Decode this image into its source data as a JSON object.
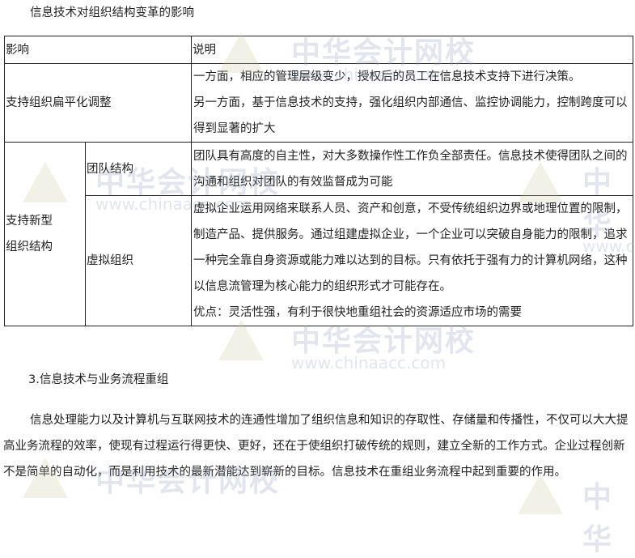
{
  "title": "信息技术对组织结构变革的影响",
  "table": {
    "headers": [
      "影响",
      "说明"
    ],
    "row1": {
      "impact": "支持组织扁平化调整",
      "desc_lines": [
        "一方面，相应的管理层级变少，授权后的员工在信息技术支持下进行决策。",
        "另一方面，基于信息技术的支持，强化组织内部通信、监控协调能力，控制跨度可以得到显著的扩大"
      ]
    },
    "group": {
      "impact_lines": [
        "支持新型",
        "组织结构"
      ],
      "team": {
        "label": "团队结构",
        "desc": "团队具有高度的自主性，对大多数操作性工作负全部责任。信息技术使得团队之间的沟通和组织对团队的有效监督成为可能"
      },
      "virtual": {
        "label": "虚拟组织",
        "desc": "虚拟企业运用网络来联系人员、资产和创意，不受传统组织边界或地理位置的限制，制造产品、提供服务。通过组建虚拟企业，一个企业可以突破自身能力的限制，追求一种完全靠自身资源或能力难以达到的目标。只有依托于强有力的计算机网络，这种以信息流管理为核心能力的组织形式才可能存在。",
        "advantage": "优点：灵活性强，有利于很快地重组社会的资源适应市场的需要"
      }
    }
  },
  "section_heading": "3.信息技术与业务流程重组",
  "paragraph": "信息处理能力以及计算机与互联网技术的连通性增加了组织信息和知识的存取性、存储量和传播性，不仅可以大大提高业务流程的效率，使现有过程运行得更快、更好，还在于使组织打破传统的规则，建立全新的工作方式。企业过程创新不是简单的自动化，而是利用技术的最新潜能达到崭新的目标。信息技术在重组业务流程中起到重要的作用。",
  "watermark": {
    "name": "中华会计网校",
    "url": "www.chinaacc.com"
  }
}
